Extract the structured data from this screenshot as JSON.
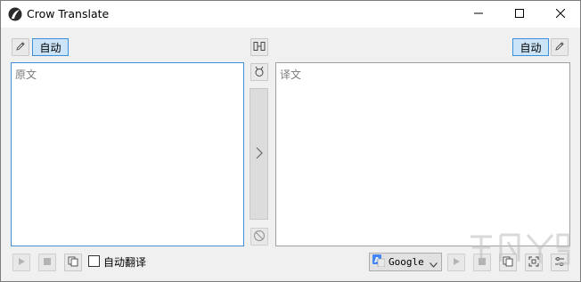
{
  "window": {
    "title": "Crow Translate",
    "minimize_icon": "minimize-icon",
    "maximize_icon": "maximize-icon",
    "close_icon": "close-icon"
  },
  "source": {
    "language_button_label": "自动",
    "edit_icon": "pencil-icon",
    "placeholder": "原文",
    "auto_translate_label": "自动翻译",
    "auto_translate_checked": false
  },
  "translation": {
    "language_button_label": "自动",
    "edit_icon": "pencil-icon",
    "placeholder": "译文"
  },
  "center": {
    "swap_icon": "swap-languages-icon",
    "clear_icon": "broom-icon",
    "translate_icon": "chevron-right-icon",
    "abort_icon": "cancel-icon"
  },
  "engine": {
    "selected": "Google",
    "icon": "google-translate-icon"
  },
  "colors": {
    "accent": "#3c8fd8",
    "selected_bg": "#cce4f7",
    "client_bg": "#f0f0f0"
  }
}
